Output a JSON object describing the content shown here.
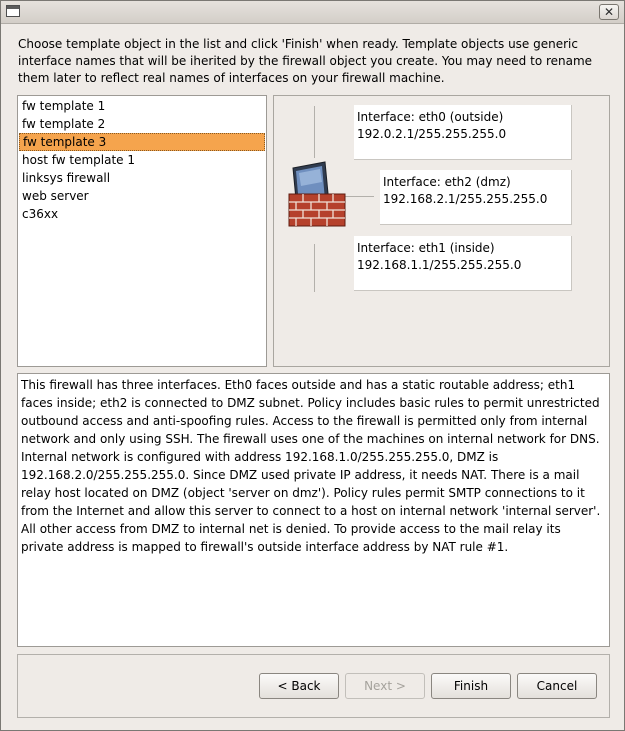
{
  "window": {
    "title": "",
    "close_glyph": "✕"
  },
  "intro_text": "Choose template object in the list and click 'Finish' when ready. Template objects use generic interface names that will be iherited by the firewall object you create. You may need to rename them later to reflect real names of interfaces on your firewall machine.",
  "templates": {
    "items": [
      "fw template 1",
      "fw template 2",
      "fw template 3",
      "host fw template 1",
      "linksys firewall",
      "web server",
      "c36xx"
    ],
    "selected_index": 2
  },
  "preview": {
    "interfaces": [
      {
        "label": "Interface: eth0 (outside)",
        "address": "192.0.2.1/255.255.255.0"
      },
      {
        "label": "Interface: eth2 (dmz)",
        "address": "192.168.2.1/255.255.255.0"
      },
      {
        "label": "Interface: eth1 (inside)",
        "address": "192.168.1.1/255.255.255.0"
      }
    ],
    "icon": "firewall-icon"
  },
  "description": "This firewall has three interfaces. Eth0 faces outside and has a static routable address; eth1 faces inside; eth2 is connected to DMZ subnet. Policy includes basic rules to permit unrestricted outbound access and anti-spoofing rules. Access to the firewall is permitted only from internal network and only using SSH. The firewall uses one of the machines on internal network for DNS. Internal network is configured with address 192.168.1.0/255.255.255.0, DMZ is 192.168.2.0/255.255.255.0. Since DMZ used private IP address, it needs NAT. There is a mail relay host located on DMZ (object 'server on dmz'). Policy rules permit SMTP connections to it from the Internet and allow this server to connect to a host on internal network 'internal server'. All other access from DMZ to internal net is denied. To provide access to the mail relay its private address is mapped to firewall's outside interface address by NAT rule #1.",
  "buttons": {
    "back": "< Back",
    "next": "Next >",
    "finish": "Finish",
    "cancel": "Cancel"
  },
  "colors": {
    "selection": "#f5a44d",
    "window_bg": "#efebe7"
  }
}
